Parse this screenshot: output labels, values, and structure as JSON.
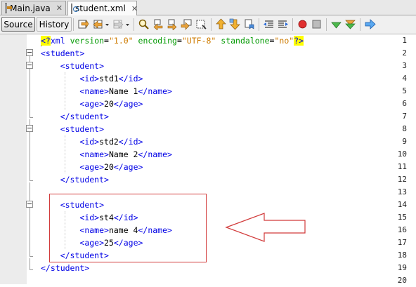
{
  "tabs": [
    {
      "label": "Main.java",
      "icon": "java-file-icon"
    },
    {
      "label": "student.xml",
      "icon": "xml-file-icon"
    }
  ],
  "close_glyph": "✕",
  "view_buttons": {
    "source": "Source",
    "history": "History"
  },
  "lines": [
    {
      "n": "1"
    },
    {
      "n": "2"
    },
    {
      "n": "3"
    },
    {
      "n": "4"
    },
    {
      "n": "5"
    },
    {
      "n": "6"
    },
    {
      "n": "7"
    },
    {
      "n": "8"
    },
    {
      "n": "9"
    },
    {
      "n": "10"
    },
    {
      "n": "11"
    },
    {
      "n": "12"
    },
    {
      "n": "13"
    },
    {
      "n": "14"
    },
    {
      "n": "15"
    },
    {
      "n": "16"
    },
    {
      "n": "17"
    },
    {
      "n": "18"
    },
    {
      "n": "19"
    },
    {
      "n": "20"
    }
  ],
  "code": {
    "xml_decl": {
      "open": "<?",
      "name": "xml",
      "attrs": [
        {
          "name": "version",
          "value": "\"1.0\""
        },
        {
          "name": "encoding",
          "value": "\"UTF-8\""
        },
        {
          "name": "standalone",
          "value": "\"no\""
        }
      ],
      "close": "?>"
    },
    "tag_student_open": "<student>",
    "tag_student_close": "</student>",
    "records": [
      {
        "id_open": "<id>",
        "id": "std1",
        "id_close": "</id>",
        "name_open": "<name>",
        "name": "Name 1",
        "name_close": "</name>",
        "age_open": "<age>",
        "age": "20",
        "age_close": "</age>"
      },
      {
        "id_open": "<id>",
        "id": "std2",
        "id_close": "</id>",
        "name_open": "<name>",
        "name": "Name 2",
        "name_close": "</name>",
        "age_open": "<age>",
        "age": "20",
        "age_close": "</age>"
      },
      {
        "id_open": "<id>",
        "id": "st4",
        "id_close": "</id>",
        "name_open": "<name>",
        "name": "name 4",
        "name_close": "</name>",
        "age_open": "<age>",
        "age": "25",
        "age_close": "</age>"
      }
    ]
  },
  "colors": {
    "tag": "#0000e6",
    "attr": "#009900",
    "value": "#ce7b00",
    "pi_highlight": "#ffff00",
    "annotation": "#d23b3b"
  },
  "toolbar_icons": [
    "last-edit-icon",
    "back-icon",
    "forward-icon",
    "find-icon",
    "find-previous-icon",
    "find-next-icon",
    "find-selection-icon",
    "toggle-highlight-icon",
    "previous-bookmark-icon",
    "next-bookmark-icon",
    "toggle-bookmark-icon",
    "shift-left-icon",
    "shift-right-icon",
    "start-macro-icon",
    "stop-macro-icon",
    "check-xml-icon",
    "validate-xml-icon",
    "xsl-transform-icon"
  ]
}
